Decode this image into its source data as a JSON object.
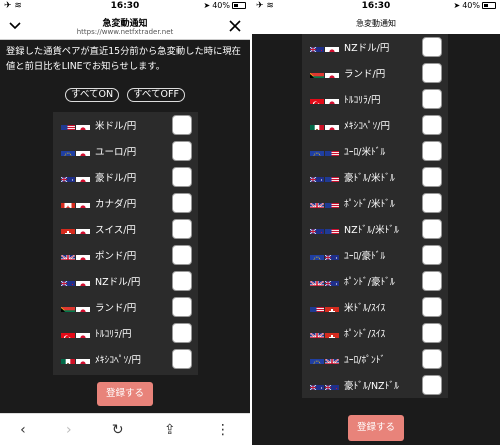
{
  "left": {
    "status": {
      "time": "16:30",
      "battery": "40%"
    },
    "header": {
      "title": "急変動通知",
      "url": "https://www.netfxtrader.net"
    },
    "description": "登録した通貨ペアが直近15分前から急変動した時に現在値と前日比をLINEでお知らせします。",
    "all_on": "すべてON",
    "all_off": "すべてOFF",
    "pairs": [
      {
        "label": "米ドル/円",
        "flag1": "us",
        "flag2": "jp"
      },
      {
        "label": "ユーロ/円",
        "flag1": "eu",
        "flag2": "jp"
      },
      {
        "label": "豪ドル/円",
        "flag1": "au",
        "flag2": "jp"
      },
      {
        "label": "カナダ/円",
        "flag1": "ca",
        "flag2": "jp"
      },
      {
        "label": "スイス/円",
        "flag1": "ch",
        "flag2": "jp"
      },
      {
        "label": "ポンド/円",
        "flag1": "gb",
        "flag2": "jp"
      },
      {
        "label": "NZドル/円",
        "flag1": "nz",
        "flag2": "jp"
      },
      {
        "label": "ランド/円",
        "flag1": "za",
        "flag2": "jp"
      },
      {
        "label": "ﾄﾙｺﾘﾗ/円",
        "flag1": "tr",
        "flag2": "jp"
      },
      {
        "label": "ﾒｷｼｺﾍﾟｿ/円",
        "flag1": "mx",
        "flag2": "jp"
      }
    ],
    "register": "登録する"
  },
  "right": {
    "status": {
      "time": "16:30",
      "battery": "40%"
    },
    "header": {
      "title": "急変動通知"
    },
    "pairs": [
      {
        "label": "NZドル/円",
        "flag1": "nz",
        "flag2": "jp"
      },
      {
        "label": "ランド/円",
        "flag1": "za",
        "flag2": "jp"
      },
      {
        "label": "ﾄﾙｺﾘﾗ/円",
        "flag1": "tr",
        "flag2": "jp"
      },
      {
        "label": "ﾒｷｼｺﾍﾟｿ/円",
        "flag1": "mx",
        "flag2": "jp"
      },
      {
        "label": "ﾕｰﾛ/米ﾄﾞﾙ",
        "flag1": "eu",
        "flag2": "us"
      },
      {
        "label": "豪ﾄﾞﾙ/米ﾄﾞﾙ",
        "flag1": "au",
        "flag2": "us"
      },
      {
        "label": "ﾎﾟﾝﾄﾞ/米ﾄﾞﾙ",
        "flag1": "gb",
        "flag2": "us"
      },
      {
        "label": "NZﾄﾞﾙ/米ﾄﾞﾙ",
        "flag1": "nz",
        "flag2": "us"
      },
      {
        "label": "ﾕｰﾛ/豪ﾄﾞﾙ",
        "flag1": "eu",
        "flag2": "au"
      },
      {
        "label": "ﾎﾟﾝﾄﾞ/豪ﾄﾞﾙ",
        "flag1": "gb",
        "flag2": "au"
      },
      {
        "label": "米ﾄﾞﾙ/ｽｲｽ",
        "flag1": "us",
        "flag2": "ch"
      },
      {
        "label": "ﾎﾟﾝﾄﾞ/ｽｲｽ",
        "flag1": "gb",
        "flag2": "ch"
      },
      {
        "label": "ﾕｰﾛ/ﾎﾟﾝﾄﾞ",
        "flag1": "eu",
        "flag2": "gb"
      },
      {
        "label": "豪ﾄﾞﾙ/NZﾄﾞﾙ",
        "flag1": "au",
        "flag2": "nz"
      }
    ],
    "register": "登録する"
  },
  "colors": {
    "register_bg": "#e8837a",
    "panel_bg": "#1b1b1b",
    "row_bg": "#2b2b2b"
  }
}
